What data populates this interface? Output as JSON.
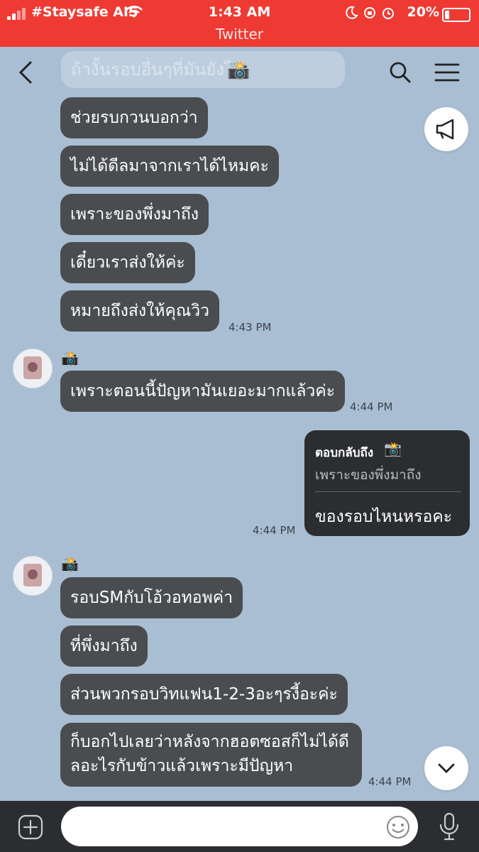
{
  "status_bar": {
    "carrier": "#Staysafe AIS",
    "time": "1:43 AM",
    "battery": "20%",
    "back_app": "Twitter"
  },
  "header": {
    "back_icon": "chevron-left-icon",
    "search_icon": "search-icon",
    "menu_icon": "hamburger-menu-icon",
    "ghost_text": "ถ้างั้นรอบอื่นๆที่มันยังไม่"
  },
  "messages": [
    {
      "text": "ช่วยรบกวนบอกว่า"
    },
    {
      "text": "ไม่ได้ดีลมาจากเราได้ไหมคะ"
    },
    {
      "text": "เพราะของพึ่งมาถึง"
    },
    {
      "text": "เดี๋ยวเราส่งให้ค่ะ"
    },
    {
      "text": "หมายถึงส่งให้คุณวิว",
      "time": "4:43 PM"
    },
    {
      "sender_icon": "camera-flash-icon",
      "text": "เพราะตอนนี้ปัญหามันเยอะมากแล้วค่ะ",
      "time": "4:44 PM"
    },
    {
      "reply_title": "ตอบกลับถึง",
      "reply_quote": "เพราะของพึ่งมาถึง",
      "text": "ของรอบไหนหรอคะ",
      "time": "4:44 PM"
    },
    {
      "sender_icon": "camera-flash-icon",
      "text": "รอบSMกับโอ้วอทอพค่า"
    },
    {
      "text": "ที่พึ่งมาถึง"
    },
    {
      "text": "ส่วนพวกรอบวิทแฟน1-2-3อะๆรงี้อะค่ะ"
    },
    {
      "text": "ก็บอกไปเลยว่าหลังจากฮอตซอสก็ไม่ได้ดีลอะไรกับข้าวแล้วเพราะมีปัญหา",
      "time": "4:44 PM"
    }
  ],
  "input": {
    "placeholder": ""
  },
  "colors": {
    "status_bar": "#ee3a33",
    "chat_bg": "#a9bed2",
    "bubble_in": "#4a4c4f",
    "bubble_out": "#2b2d30"
  }
}
